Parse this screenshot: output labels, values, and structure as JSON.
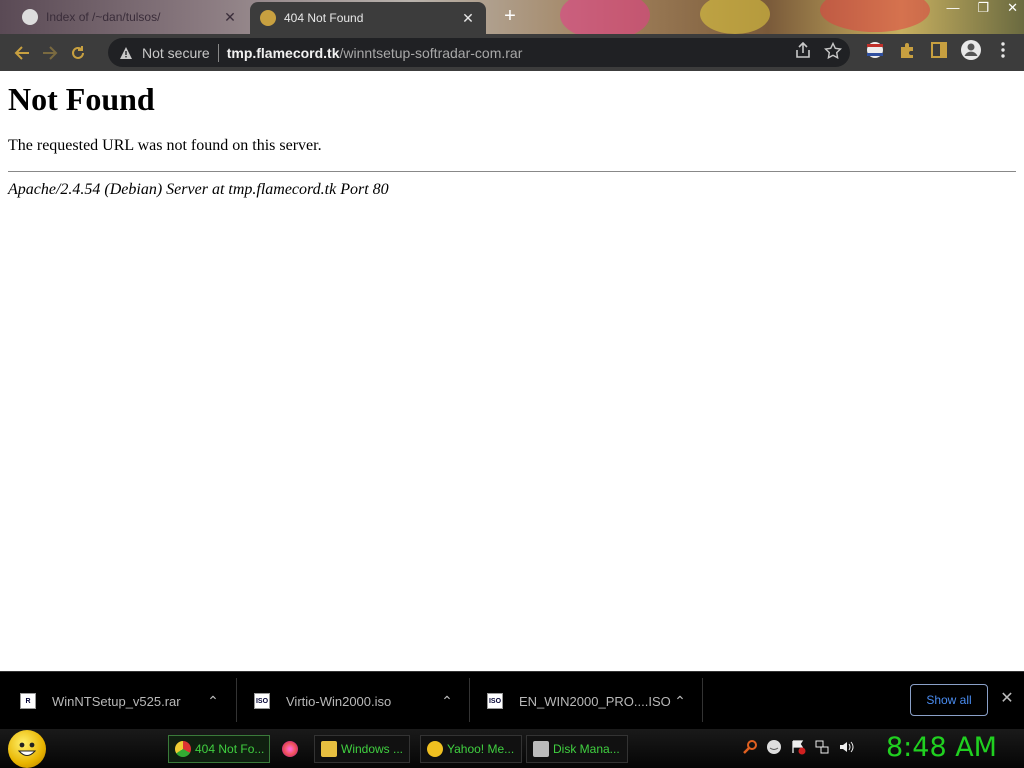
{
  "tabs": [
    {
      "label": "Index of /~dan/tulsos/",
      "active": false
    },
    {
      "label": "404 Not Found",
      "active": true
    }
  ],
  "omnibox": {
    "security_label": "Not secure",
    "host": "tmp.flamecord.tk",
    "path": "/winntsetup-softradar-com.rar"
  },
  "page": {
    "heading": "Not Found",
    "message": "The requested URL was not found on this server.",
    "signature": "Apache/2.4.54 (Debian) Server at tmp.flamecord.tk Port 80"
  },
  "downloads": [
    {
      "filename": "WinNTSetup_v525.rar",
      "icon": "rar-file-icon"
    },
    {
      "filename": "Virtio-Win2000.iso",
      "icon": "iso-file-icon"
    },
    {
      "filename": "EN_WIN2000_PRO....ISO",
      "icon": "iso-file-icon"
    }
  ],
  "shelf": {
    "show_all_label": "Show all"
  },
  "taskbar": {
    "tasks": [
      {
        "label": "404 Not Fo...",
        "icon": "chrome-icon",
        "active": true
      },
      {
        "label": "",
        "icon": "firefox-icon",
        "active": false
      },
      {
        "label": "Windows ...",
        "icon": "folder-icon",
        "active": false
      },
      {
        "label": "Yahoo! Me...",
        "icon": "yahoo-messenger-icon",
        "active": false
      },
      {
        "label": "Disk Mana...",
        "icon": "disk-management-icon",
        "active": false
      }
    ],
    "clock": "8:48 AM"
  },
  "colors": {
    "toolbar_bg": "#3c3c3c",
    "omnibox_bg": "#202124",
    "clock_green": "#20d020",
    "show_all_blue": "#4a8cf0"
  }
}
